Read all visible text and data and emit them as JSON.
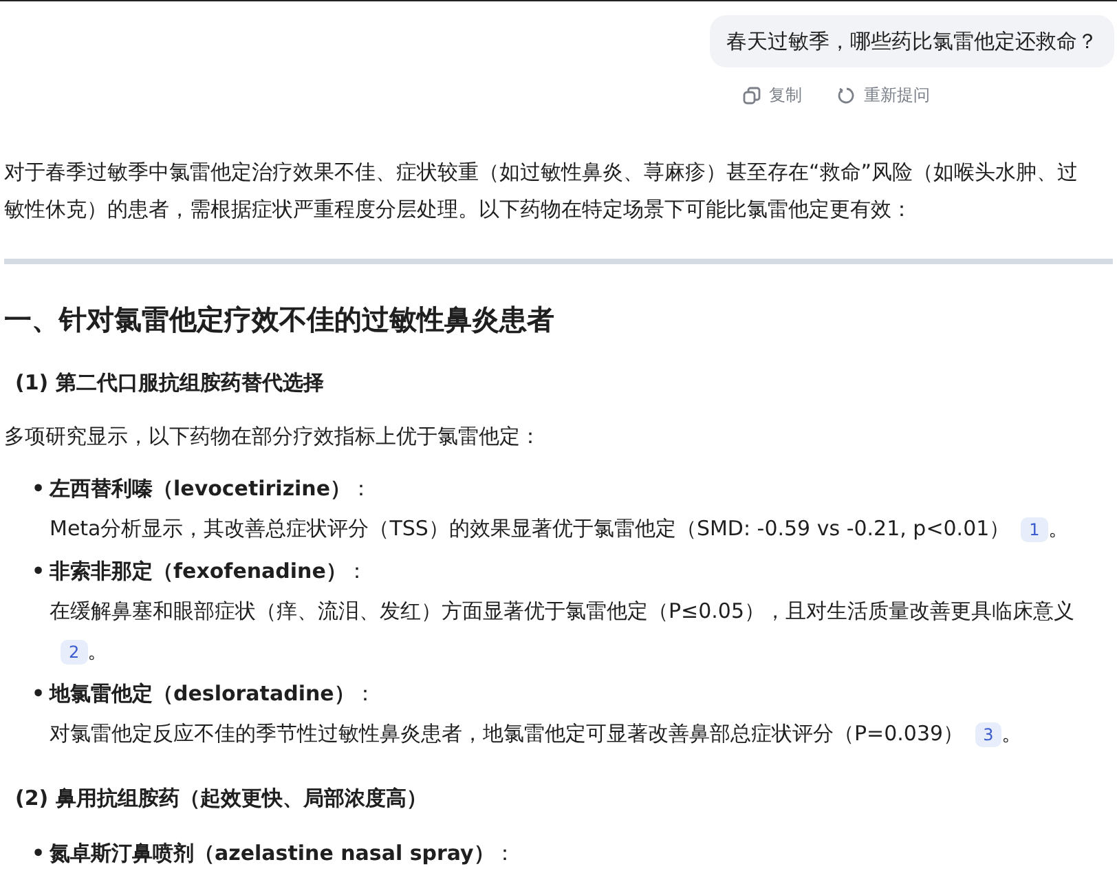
{
  "question": {
    "text": "春天过敏季，哪些药比氯雷他定还救命？",
    "actions": [
      {
        "kind": "copy",
        "label": "复制"
      },
      {
        "kind": "retry",
        "label": "重新提问"
      }
    ]
  },
  "intro": "对于春季过敏季中氯雷他定治疗效果不佳、症状较重（如过敏性鼻炎、荨麻疹）甚至存在“救命”风险（如喉头水肿、过敏性休克）的患者，需根据症状严重程度分层处理。以下药物在特定场景下可能比氯雷他定更有效：",
  "section": {
    "heading": "一、针对氯雷他定疗效不佳的过敏性鼻炎患者",
    "subsections": [
      {
        "heading": "(1) 第二代口服抗组胺药替代选择",
        "lead": "多项研究显示，以下药物在部分疗效指标上优于氯雷他定：",
        "items": [
          {
            "bullet": "•",
            "title": "**左西替利嗪（levocetirizine）**：",
            "text": "Meta分析显示，其改善总症状评分（TSS）的效果显著优于氯雷他定（SMD: -0.59 vs -0.21, p<0.01）",
            "citation": "1",
            "tail": "。"
          },
          {
            "bullet": "•",
            "title": "**非索非那定（fexofenadine）**：",
            "text": "在缓解鼻塞和眼部症状（痒、流泪、发红）方面显著优于氯雷他定（P≤0.05），且对生活质量改善更具临床意义",
            "citation": "2",
            "tail": "。"
          },
          {
            "bullet": "•",
            "title": "**地氯雷他定（desloratadine）**：",
            "text": "对氯雷他定反应不佳的季节性过敏性鼻炎患者，地氯雷他定可显著改善鼻部总症状评分（P=0.039）",
            "citation": "3",
            "tail": "。"
          }
        ]
      },
      {
        "heading": "(2) 鼻用抗组胺药（起效更快、局部浓度高）",
        "items": [
          {
            "bullet": "•",
            "title": "**氮卓斯汀鼻喷剂（azelastine nasal spray）**："
          }
        ]
      }
    ]
  }
}
